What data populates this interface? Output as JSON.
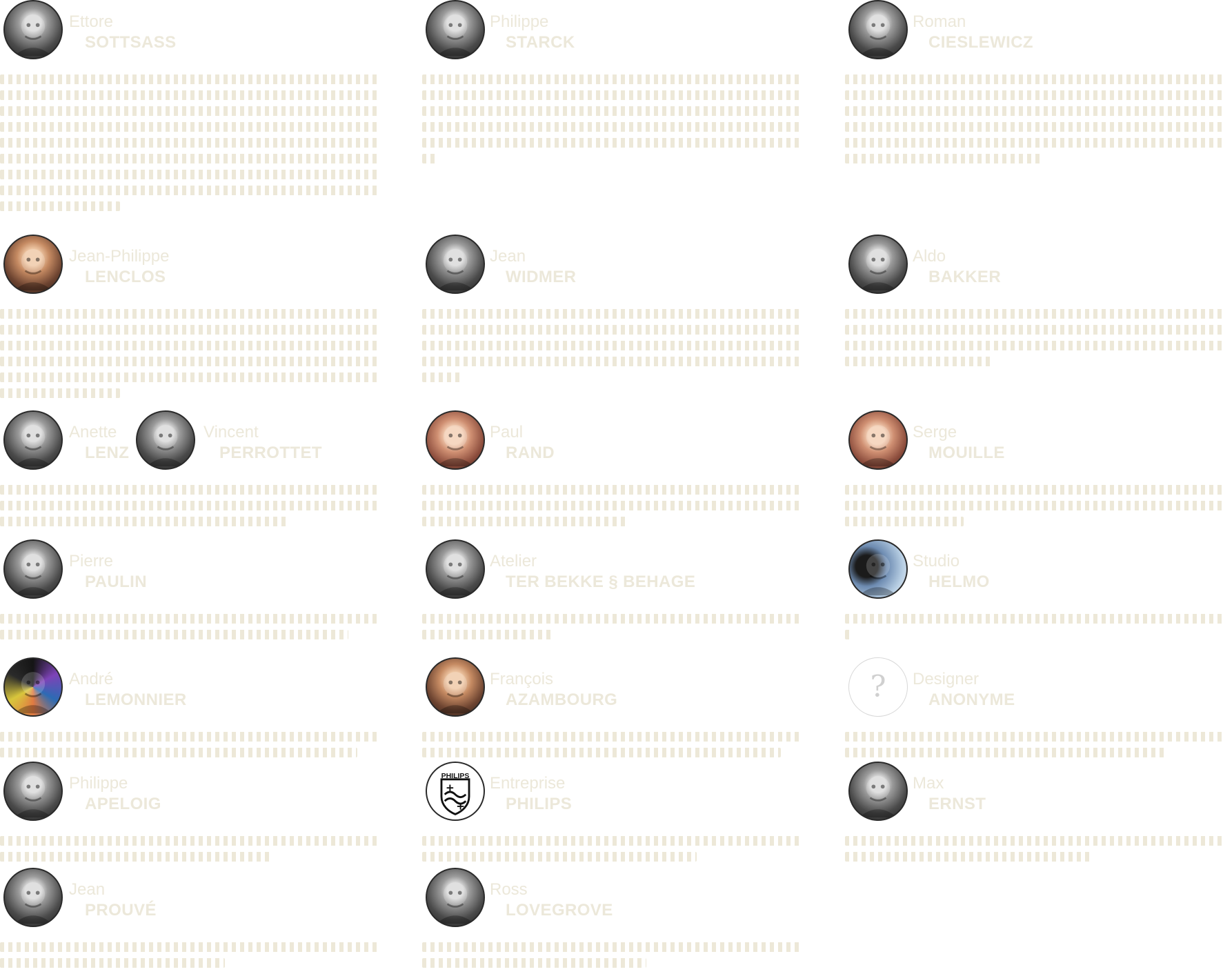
{
  "designers": [
    {
      "first": "Ettore",
      "last": "SOTTSASS",
      "lines": [
        548,
        548,
        548,
        548,
        548,
        548,
        548,
        548,
        174
      ],
      "avatar": "bw"
    },
    {
      "first": "Philippe",
      "last": "STARCK",
      "lines": [
        548,
        548,
        548,
        548,
        548,
        24
      ],
      "avatar": "bw"
    },
    {
      "first": "Roman",
      "last": "CIESLEWICZ",
      "lines": [
        548,
        548,
        548,
        548,
        548,
        285
      ],
      "avatar": "bw"
    },
    {
      "first": "Jean-Philippe",
      "last": "LENCLOS",
      "lines": [
        548,
        548,
        548,
        548,
        548,
        174
      ],
      "avatar": "photo-color"
    },
    {
      "first": "Jean",
      "last": "WIDMER",
      "lines": [
        548,
        548,
        548,
        548,
        58
      ],
      "avatar": "bw"
    },
    {
      "first": "Aldo",
      "last": "BAKKER",
      "lines": [
        548,
        548,
        548,
        216
      ],
      "avatar": "bw"
    },
    {
      "first": "Anette",
      "last": "LENZ",
      "first2": "Vincent",
      "last2": "PERROTTET",
      "lines": [
        548,
        548,
        420
      ],
      "avatar": "bw"
    },
    {
      "first": "Paul",
      "last": "RAND",
      "lines": [
        548,
        548,
        300
      ],
      "avatar": "photo-warm"
    },
    {
      "first": "Serge",
      "last": "MOUILLE",
      "lines": [
        548,
        548,
        172
      ],
      "avatar": "photo-warm"
    },
    {
      "first": "Pierre",
      "last": "PAULIN",
      "lines": [
        548,
        505
      ],
      "avatar": "bw"
    },
    {
      "first": "Atelier",
      "last": "TER BEKKE § BEHAGE",
      "lines": [
        548,
        188
      ],
      "avatar": "bw"
    },
    {
      "first": "Studio",
      "last": "HELMO",
      "lines": [
        548,
        12
      ],
      "avatar": "photo-blue"
    },
    {
      "first": "André",
      "last": "LEMONNIER",
      "lines": [
        548,
        518
      ],
      "avatar": "photo-art"
    },
    {
      "first": "François",
      "last": "AZAMBOURG",
      "lines": [
        548,
        520
      ],
      "avatar": "photo-color"
    },
    {
      "first": "Designer",
      "last": "ANONYME",
      "lines": [
        548,
        468
      ],
      "avatar": "unknown"
    },
    {
      "first": "Philippe",
      "last": "APELOIG",
      "lines": [
        548,
        392
      ],
      "avatar": "bw"
    },
    {
      "first": "Entreprise",
      "last": "PHILIPS",
      "lines": [
        548,
        398
      ],
      "avatar": "logo"
    },
    {
      "first": "Max",
      "last": "ERNST",
      "lines": [
        548,
        355
      ],
      "avatar": "bw"
    },
    {
      "first": "Jean",
      "last": "PROUVÉ",
      "lines": [
        548,
        326
      ],
      "avatar": "bw"
    },
    {
      "first": "Ross",
      "last": "LOVEGROVE",
      "lines": [
        548,
        325
      ],
      "avatar": "bw"
    }
  ],
  "logo_text": "PHILIPS",
  "unknown_symbol": "?",
  "icons": {
    "avatar": "portrait-icon",
    "unknown": "question-mark-icon",
    "logo": "philips-shield-icon"
  },
  "colors": {
    "text": "#ece8da",
    "dots": "#ede8d8",
    "avatar_border": "#2a2a2a"
  }
}
